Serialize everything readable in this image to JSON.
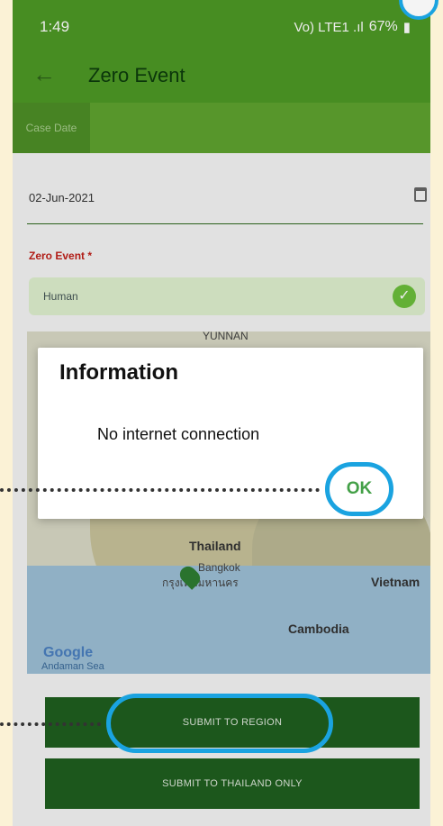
{
  "status_bar": {
    "time": "1:49",
    "signal_text": "Vo) LTE1 .ıl",
    "battery": "67%"
  },
  "app_bar": {
    "title": "Zero Event"
  },
  "tabs": [
    {
      "label": "Case Date"
    }
  ],
  "form": {
    "date_value": "02-Jun-2021",
    "zero_event_label": "Zero Event *",
    "zero_event_value": "Human"
  },
  "map": {
    "labels": {
      "yunnan": "YUNNAN",
      "thailand": "Thailand",
      "bangkok": "Bangkok",
      "bangkok_thai": "กรุงเทพมหานคร",
      "vietnam": "Vietnam",
      "cambodia": "Cambodia",
      "google": "Google",
      "andaman": "Andaman Sea"
    }
  },
  "buttons": {
    "submit_region": "SUBMIT TO REGION",
    "submit_thailand": "SUBMIT TO THAILAND ONLY"
  },
  "dialog": {
    "title": "Information",
    "message": "No internet connection",
    "ok": "OK"
  },
  "colors": {
    "primary_green": "#4e9a25",
    "highlight_blue": "#1aa3e0",
    "ok_green": "#43a047"
  }
}
